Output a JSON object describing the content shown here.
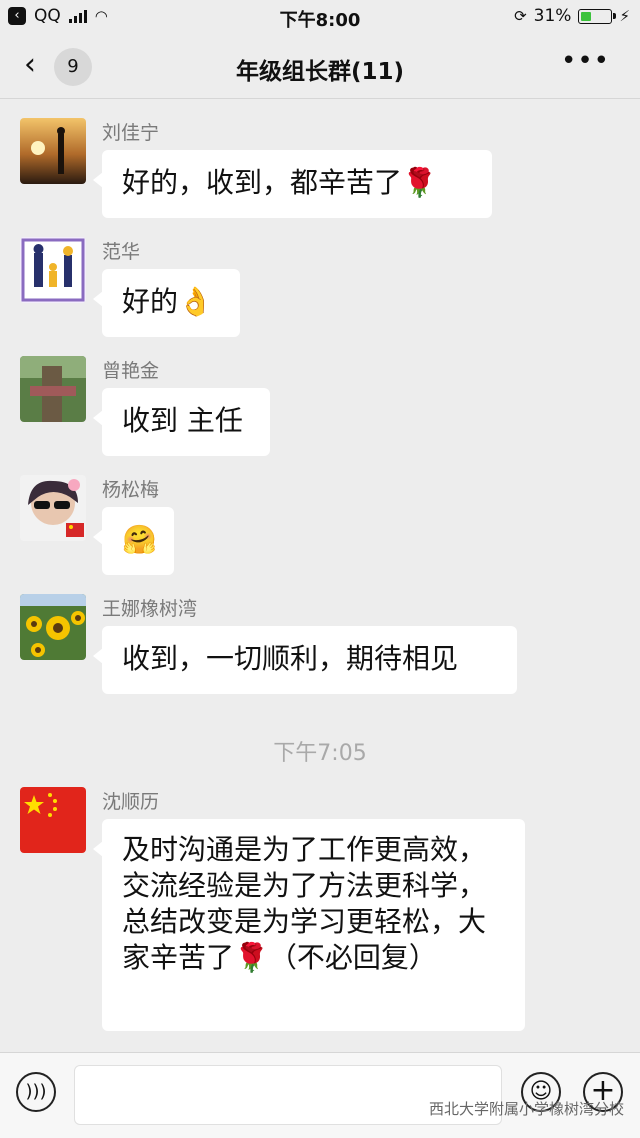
{
  "status_bar": {
    "app": "QQ",
    "time": "下午8:00",
    "battery": "31%",
    "battery_level": 0.31
  },
  "header": {
    "back_count": "9",
    "title": "年级组长群(11)"
  },
  "messages": [
    {
      "sender": "刘佳宁",
      "text": "好的，收到，都辛苦了🌹"
    },
    {
      "sender": "范华",
      "text": "好的👌"
    },
    {
      "sender": "曾艳金",
      "text": "收到 主任"
    },
    {
      "sender": "杨松梅",
      "text": "🤗"
    },
    {
      "sender": "王娜橡树湾",
      "text": "收到，一切顺利，期待相见"
    },
    {
      "sender": "沈顺历",
      "text": "及时沟通是为了工作更高效，交流经验是为了方法更科学，总结改变是为学习更轻松，大家辛苦了🌹（不必回复）"
    }
  ],
  "timestamp": "下午7:05",
  "watermark": "西北大学附属小学橡树湾分校",
  "colors": {
    "background": "#ededed",
    "bubble": "#ffffff",
    "sender": "#7a7a7a",
    "battery_fill": "#3cc23c"
  }
}
